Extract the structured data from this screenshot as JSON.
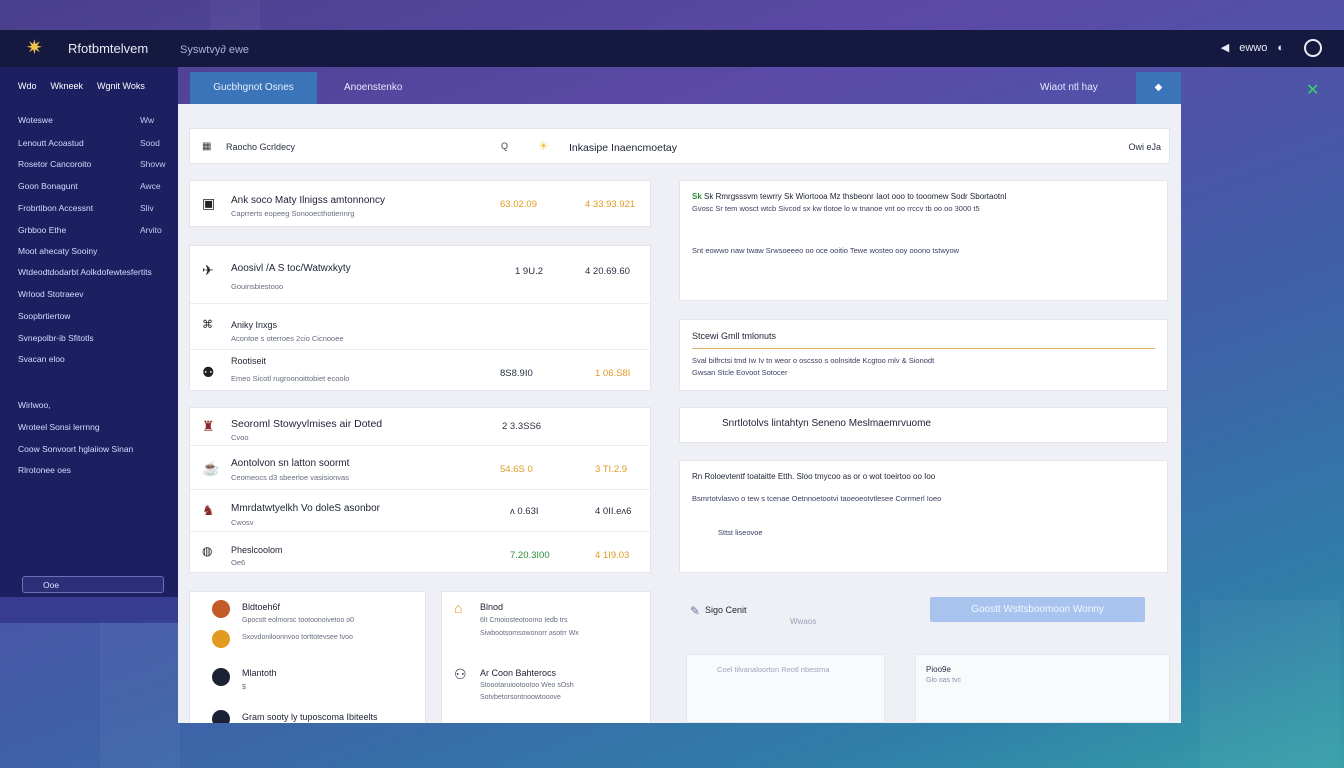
{
  "app": {
    "brand": "Rfotbmtelvem",
    "brand_sub": "Syswtvy∂ ewe",
    "top_right_label": "ewwo",
    "colors": {
      "accent": "#3b74b8",
      "sidebar": "#1c2060",
      "topbar": "#16193f",
      "positive": "#2c8a3c",
      "warning": "#e09b20"
    }
  },
  "sidebar": {
    "tabs": [
      "Wdo",
      "Wkneek",
      "Wgnit Woks"
    ],
    "items": [
      {
        "label": "Woteswe",
        "value": "Ww"
      },
      {
        "label": "Lenoutt Acoastud",
        "value": "Sood"
      },
      {
        "label": "Rosetor Cancoroito",
        "value": "Shovw"
      },
      {
        "label": "Goon Bonagunt",
        "value": "Awce"
      },
      {
        "label": "Frobrtibon Accessnt",
        "value": "Sliv"
      },
      {
        "label": "Grbboo Ethe",
        "value": "Arvito"
      },
      {
        "label": "Moot ahecaty Sooiny",
        "value": ""
      },
      {
        "label": "Wtdeodtdodarbt Aolkdofewtesfertits",
        "value": ""
      },
      {
        "label": "Wrlood Stotraeev",
        "value": ""
      },
      {
        "label": "Soopbrtiertow",
        "value": ""
      },
      {
        "label": "Svnepolbr-ib Sfitotls",
        "value": ""
      },
      {
        "label": "Svacan eloo",
        "value": ""
      },
      {
        "label": "Wirlwoo,",
        "value": ""
      },
      {
        "label": "Wroteel Sonsi lerrnng",
        "value": ""
      },
      {
        "label": "Coow Sonvoort hglaiiow Sinan",
        "value": ""
      },
      {
        "label": "Rlrotonee oes",
        "value": ""
      }
    ],
    "button_label": "Ooe"
  },
  "tabs": {
    "active": "Gucbhgnot Osnes",
    "second": "Anoenstenko",
    "right_label": "Wiaot ntl hay",
    "right_button": "◆"
  },
  "searchbar": {
    "label": "Raocho Gcrldecy",
    "query_icon": "Q",
    "title": "Inkasipe Inaencmoetay",
    "right": "Owi eJa"
  },
  "table_a": [
    {
      "title": "Ank soco Maty Ilnigss amtonnoncy",
      "sub": "Caprrerts eopeeg Sonooecthotiennrg",
      "v1": "63.02.09",
      "v2": "4 33.93.921",
      "v1_color": "orange",
      "v2_color": "orange"
    },
    {
      "title": "Aoosivl /A S toc/Watwxkyty",
      "sub": "Gouinsbiestooo",
      "v1": "1 9U.2",
      "v2": "4 20.69.60",
      "v1_color": "dark",
      "v2_color": "dark"
    },
    {
      "title": "Aniky Inxgs",
      "sub": "Acontoe s oterroes 2cio Cicnooee",
      "v1": "",
      "v2": "",
      "v1_color": "dark",
      "v2_color": "dark"
    },
    {
      "title": "Rootiseit",
      "sub": "Emeo Sicotl rugroonoittobiet ecoolo",
      "v1": "8S8.9I0",
      "v2": "1 06.S8I",
      "v1_color": "dark",
      "v2_color": "orange"
    }
  ],
  "table_b": [
    {
      "title": "Seoroml Stowyvlmises air Doted",
      "sub": "Cvoo",
      "v1": "2 3.3SS6",
      "v2": "",
      "v1_color": "dark",
      "v2_color": "dark"
    },
    {
      "title": "Aontolvon sn latton soormt",
      "sub": "Ceomeocs d3 sbeerloe vasisionvas",
      "v1": "54.6S 0",
      "v2": "3 TI.2.9",
      "v1_color": "orange",
      "v2_color": "orange"
    },
    {
      "title": "Mmrdatwtyelkh Vo doleS asonbor",
      "sub": "Cwosv",
      "v1": "ʌ 0.63I",
      "v2": "4 0II.eʌ6",
      "v1_color": "dark",
      "v2_color": "dark"
    },
    {
      "title": "Pheslcoolom",
      "sub": "Oe6",
      "v1": "7.20.3I00",
      "v2": "4 1I9.03",
      "v1_color": "green",
      "v2_color": "orange"
    }
  ],
  "notices": [
    {
      "head": "Sk Rmrgsssvm tewrry Sk Wiortooa Mz thsbeonr Iaot ooo to tooomew Sodr Sbortaotnl",
      "body": "Gvosc Sr tem wosct wtcb Sivcod sx kw tlotoe lo w tnanoe vnt oo rrccv tb oo oo 3000 t5",
      "extra": "Snt eowwo naw twaw Srwsoeeeo oo oce ooitio Tewe wosteo ooy ooono tstwyow"
    },
    {
      "head": "Stcewi Gmll tmlonuts",
      "body": "Sval bilfrctsi tmd Iw Iv tn weor o oscsso s oolnsitde Kcgtoo mlv & Sionodt",
      "extra": "Gwsan Stcle Eovoot Sotocer"
    },
    {
      "head": "Snrtlotolvs lintahtyn Seneno Meslmaemrvuome",
      "body": "",
      "extra": ""
    },
    {
      "head": "Rn Roloevtentf toataitte Etth. Sloo tmycoo as or o wot toeirtoo oo Ioo",
      "body": "Bsmrtotvlasvo o tew s tcenae Oetnnoetootvi taoeoeotvtlesee Corrmerl Ioeo",
      "extra": "Sttst liseovoe"
    }
  ],
  "bottom_left": [
    {
      "title": "Bldtoeh6f",
      "sub": "Gpocstt eolmorsc tootoonoivetoo o0"
    },
    {
      "title": "",
      "sub": "Sxovdoniloonnvoo torttotevsee tvoo"
    },
    {
      "title": "Mlantoth",
      "sub": "$"
    },
    {
      "title": "Gram sooty ly tuposcoma Ibiteelts",
      "sub": ""
    }
  ],
  "bottom_mid": [
    {
      "title": "Blnod",
      "sub": "6lt Cmoiosteotoomo Iedb trs"
    },
    {
      "title": "",
      "sub": "Siwbootsomsowonorr asotrr Wx"
    },
    {
      "title": "Ar Coon Bahterocs",
      "sub": "Stoootaruiootootoo Weo sOsh"
    },
    {
      "title": "",
      "sub": "Sotvbetorsontnoowtooove"
    }
  ],
  "bottom_right": {
    "label": "Sigo Cenit",
    "sub": "Wwaos",
    "cta": "Goostt Wsttsboomoon Wonny",
    "ghost_a": "Coel tilvanaloorton Reotl nbestma",
    "ghost_b_title": "Pioo9e",
    "ghost_b_sub": "Glo oas tvc"
  }
}
